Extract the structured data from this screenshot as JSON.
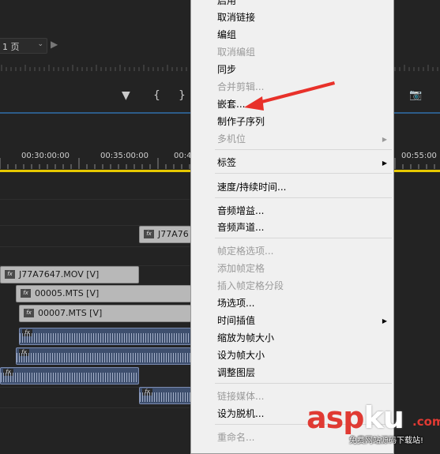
{
  "timeline": {
    "page_select": "1 页",
    "timecodes": [
      "00:30:00:00",
      "00:35:00:00",
      "00:4",
      "00:55:00"
    ],
    "clips": [
      {
        "label": "J77A76",
        "kind": "video"
      },
      {
        "label": "J77A7647.MOV [V]",
        "kind": "video"
      },
      {
        "label": "00005.MTS [V]",
        "kind": "video"
      },
      {
        "label": "00007.MTS [V]",
        "kind": "video"
      }
    ],
    "fx_badge": "fx"
  },
  "context_menu": {
    "items": [
      {
        "label": "启用",
        "enabled": true,
        "checked": true
      },
      {
        "label": "取消链接",
        "enabled": true
      },
      {
        "label": "编组",
        "enabled": true
      },
      {
        "label": "取消编组",
        "enabled": false
      },
      {
        "label": "同步",
        "enabled": true
      },
      {
        "label": "合并剪辑...",
        "enabled": false
      },
      {
        "label": "嵌套...",
        "enabled": true
      },
      {
        "label": "制作子序列",
        "enabled": true
      },
      {
        "label": "多机位",
        "enabled": false,
        "submenu": true
      },
      {
        "label": "标签",
        "enabled": true,
        "submenu": true
      },
      {
        "label": "速度/持续时间...",
        "enabled": true
      },
      {
        "label": "音频增益...",
        "enabled": true
      },
      {
        "label": "音频声道...",
        "enabled": true
      },
      {
        "label": "帧定格选项...",
        "enabled": false
      },
      {
        "label": "添加帧定格",
        "enabled": false
      },
      {
        "label": "插入帧定格分段",
        "enabled": false
      },
      {
        "label": "场选项...",
        "enabled": true
      },
      {
        "label": "时间插值",
        "enabled": true,
        "submenu": true
      },
      {
        "label": "缩放为帧大小",
        "enabled": true
      },
      {
        "label": "设为帧大小",
        "enabled": true
      },
      {
        "label": "调整图层",
        "enabled": true
      },
      {
        "label": "链接媒体...",
        "enabled": false
      },
      {
        "label": "设为脱机...",
        "enabled": true
      },
      {
        "label": "重命名...",
        "enabled": false
      }
    ]
  },
  "watermark": {
    "brand_red1": "asp",
    "brand_white": "ku",
    "tld": ".com",
    "subtitle": "免费网站源码下载站!"
  },
  "colors": {
    "playhead": "#e6c800",
    "annotation_arrow": "#e8312a",
    "menu_bg": "#f0f0f0"
  }
}
